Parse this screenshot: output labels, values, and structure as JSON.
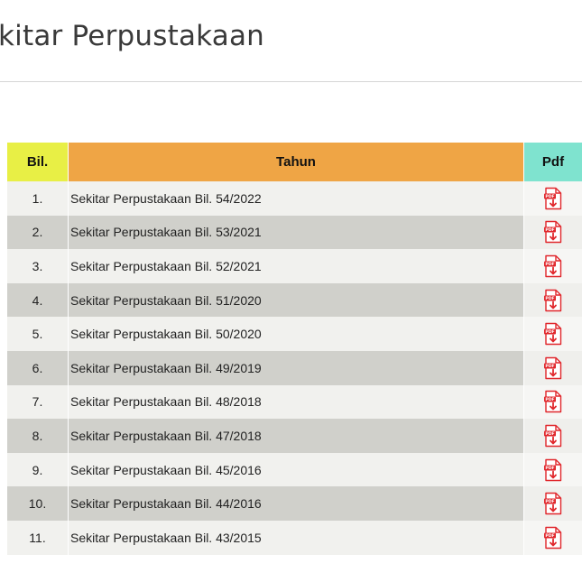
{
  "page": {
    "title": "kitar Perpustakaan"
  },
  "table": {
    "headers": {
      "bil": "Bil.",
      "tahun": "Tahun",
      "pdf": "Pdf"
    },
    "rows": [
      {
        "bil": "1.",
        "title": "Sekitar Perpustakaan Bil. 54/2022",
        "icon": "pdf-download-icon"
      },
      {
        "bil": "2.",
        "title": "Sekitar Perpustakaan Bil. 53/2021",
        "icon": "pdf-download-icon"
      },
      {
        "bil": "3.",
        "title": "Sekitar Perpustakaan Bil. 52/2021",
        "icon": "pdf-download-icon"
      },
      {
        "bil": "4.",
        "title": "Sekitar Perpustakaan Bil. 51/2020",
        "icon": "pdf-download-icon"
      },
      {
        "bil": "5.",
        "title": "Sekitar Perpustakaan Bil. 50/2020",
        "icon": "pdf-download-icon"
      },
      {
        "bil": "6.",
        "title": "Sekitar Perpustakaan Bil. 49/2019",
        "icon": "pdf-download-icon"
      },
      {
        "bil": "7.",
        "title": "Sekitar Perpustakaan Bil. 48/2018",
        "icon": "pdf-download-icon"
      },
      {
        "bil": "8.",
        "title": "Sekitar Perpustakaan Bil. 47/2018",
        "icon": "pdf-download-icon"
      },
      {
        "bil": "9.",
        "title": "Sekitar Perpustakaan Bil. 45/2016",
        "icon": "pdf-download-icon"
      },
      {
        "bil": "10.",
        "title": "Sekitar Perpustakaan Bil. 44/2016",
        "icon": "pdf-download-icon"
      },
      {
        "bil": "11.",
        "title": "Sekitar Perpustakaan Bil. 43/2015",
        "icon": "pdf-download-icon"
      }
    ]
  },
  "colors": {
    "header_bil": "#e8ef45",
    "header_tahun": "#efa545",
    "header_pdf": "#7fe3cf",
    "row_light": "#f1f1ee",
    "row_dark": "#d0d0cb",
    "pdf_icon": "#e0262b"
  }
}
